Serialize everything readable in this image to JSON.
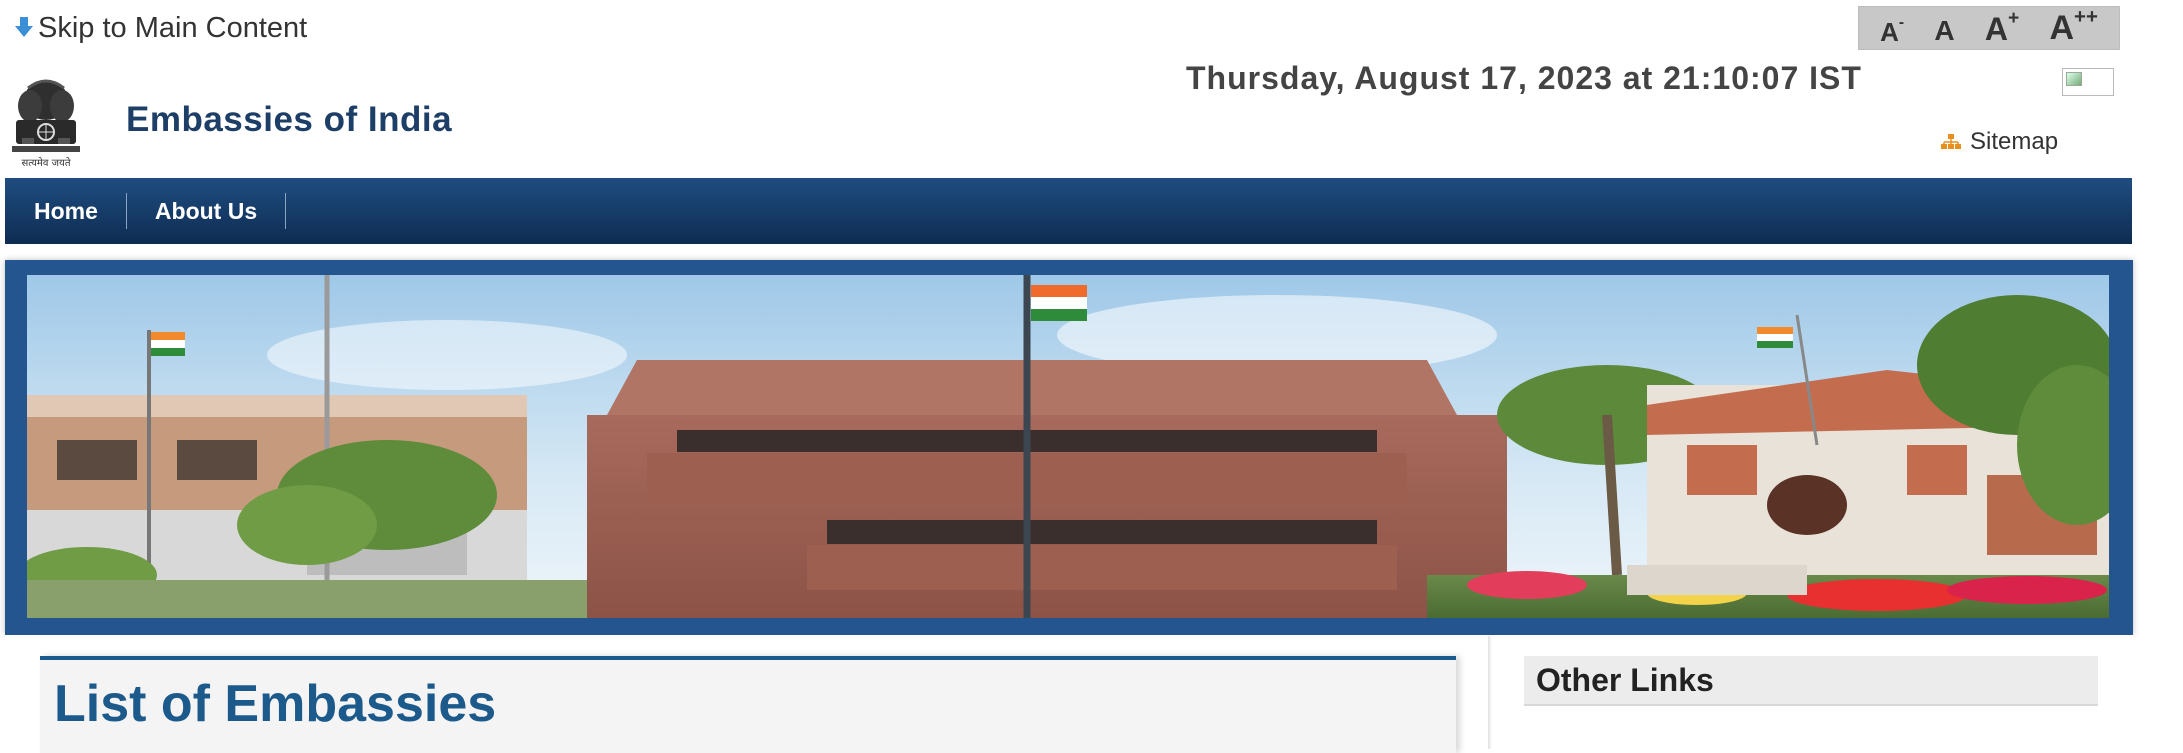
{
  "header": {
    "skip_link": "Skip to Main Content",
    "font_controls": [
      {
        "base": "A",
        "sup": "-"
      },
      {
        "base": "A",
        "sup": ""
      },
      {
        "base": "A",
        "sup": "+"
      },
      {
        "base": "A",
        "sup": "++"
      }
    ],
    "site_title": "Embassies of India",
    "datetime": "Thursday, August 17, 2023 at 21:10:07 IST",
    "sitemap": "Sitemap",
    "emblem_motto": "सत्यमेव जयते"
  },
  "nav": {
    "items": [
      "Home",
      "About Us"
    ]
  },
  "main": {
    "title": "List of Embassies"
  },
  "sidebar": {
    "title": "Other Links"
  },
  "colors": {
    "nav_bg": "#1a3f6b",
    "title_blue": "#1d5a8c",
    "banner_frame": "#24558f"
  }
}
